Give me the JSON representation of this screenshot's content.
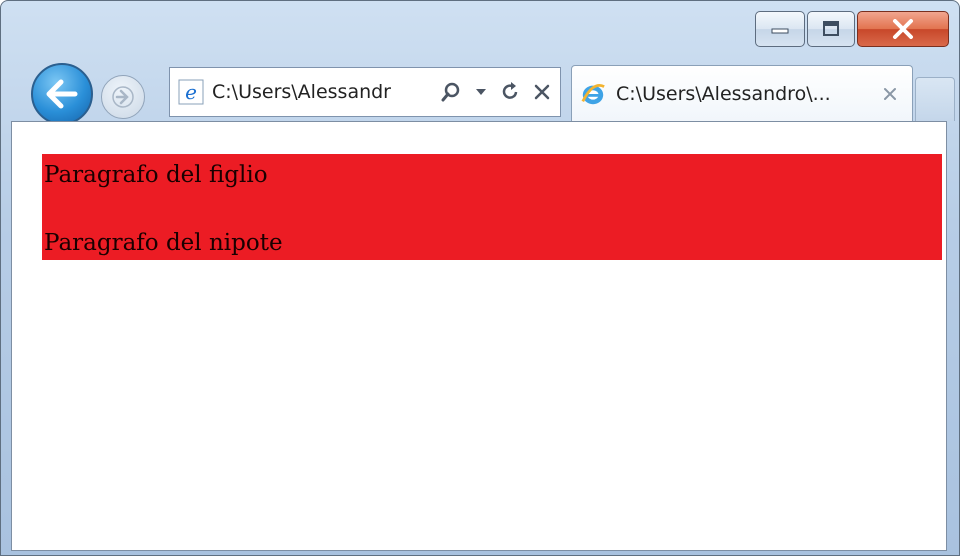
{
  "window": {
    "caption_buttons": {
      "minimize_icon": "minimize-icon",
      "maximize_icon": "maximize-icon",
      "close_icon": "close-icon"
    }
  },
  "nav": {
    "back_icon": "back-arrow-icon",
    "forward_icon": "forward-arrow-icon",
    "address": "C:\\Users\\Alessandr",
    "address_icon": "ie-page-icon",
    "tools": [
      "search-icon",
      "dropdown-arrow-icon",
      "refresh-icon",
      "stop-icon"
    ]
  },
  "tab": {
    "title": "C:\\Users\\Alessandro\\...",
    "icon": "ie-logo-icon",
    "close_icon": "tab-close-icon"
  },
  "page": {
    "background_color": "#ec1c24",
    "paragraphs": [
      "Paragrafo del figlio",
      "Paragrafo del nipote"
    ]
  }
}
